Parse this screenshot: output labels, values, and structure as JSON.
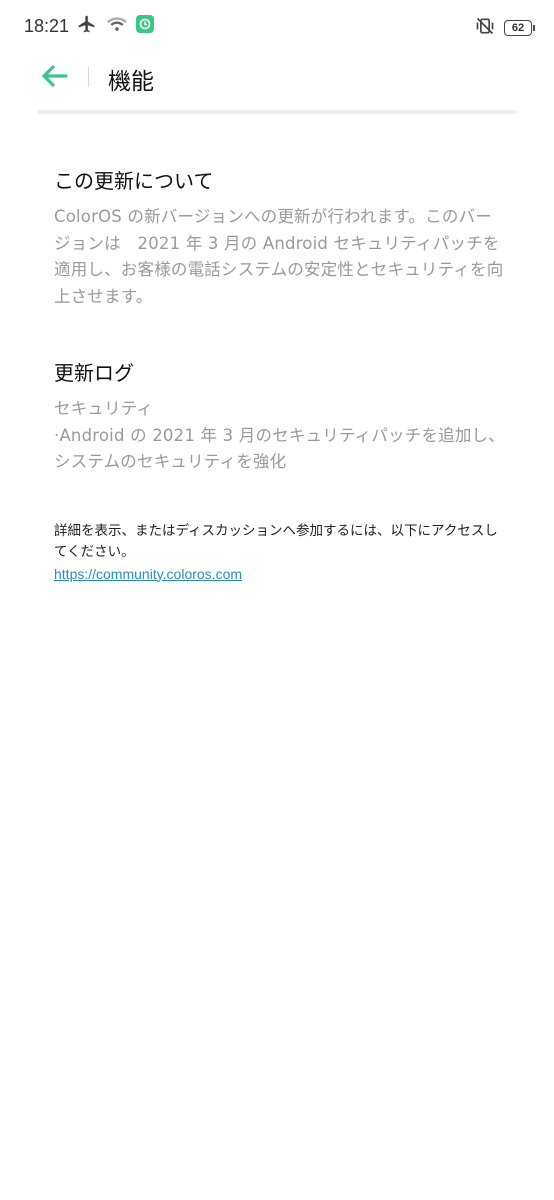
{
  "status_bar": {
    "time": "18:21",
    "battery_level": "62",
    "icons": [
      "airplane-icon",
      "wifi-icon",
      "app-notification-icon",
      "vibrate-off-icon",
      "battery-icon"
    ]
  },
  "header": {
    "title": "機能",
    "accent_color": "#3cc68a"
  },
  "about_section": {
    "heading": "この更新について",
    "body": "ColorOS の新バージョンへの更新が行われます。このバージョンは　2021 年 3 月の Android セキュリティパッチを適用し、お客様の電話システムの安定性とセキュリティを向上させます。"
  },
  "changelog_section": {
    "heading": "更新ログ",
    "lines": [
      "セキュリティ",
      "·Android の 2021 年 3 月のセキュリティパッチを追加し、システムのセキュリティを強化"
    ]
  },
  "more_info": {
    "text": "詳細を表示、またはディスカッションへ参加するには、以下にアクセスしてください。",
    "link": "https://community.coloros.com"
  }
}
